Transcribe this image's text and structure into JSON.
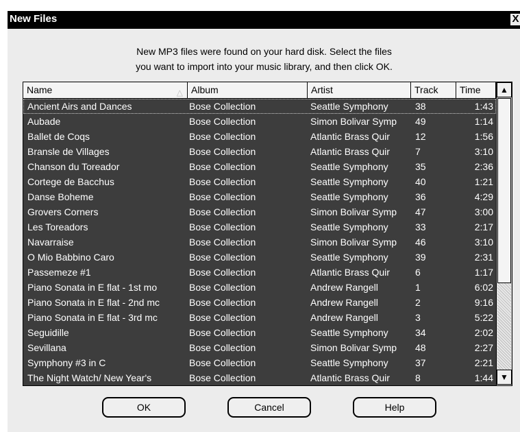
{
  "window": {
    "title": "New Files",
    "close_label": "X"
  },
  "message": {
    "line1": "New MP3 files were found on your hard disk. Select the files",
    "line2": "you want to import into your music library, and then click OK."
  },
  "columns": [
    "Name",
    "Album",
    "Artist",
    "Track",
    "Time"
  ],
  "rows": [
    [
      "Ancient Airs and Dances",
      "Bose Collection",
      "Seattle Symphony",
      "38",
      "1:43"
    ],
    [
      "Aubade",
      "Bose Collection",
      "Simon Bolivar Symp",
      "49",
      "1:14"
    ],
    [
      "Ballet de Coqs",
      "Bose Collection",
      "Atlantic Brass Quir",
      "12",
      "1:56"
    ],
    [
      "Bransle de Villages",
      "Bose Collection",
      "Atlantic Brass Quir",
      "7",
      "3:10"
    ],
    [
      "Chanson du Toreador",
      "Bose Collection",
      "Seattle Symphony",
      "35",
      "2:36"
    ],
    [
      "Cortege de Bacchus",
      "Bose Collection",
      "Seattle Symphony",
      "40",
      "1:21"
    ],
    [
      "Danse Boheme",
      "Bose Collection",
      "Seattle Symphony",
      "36",
      "4:29"
    ],
    [
      "Grovers Corners",
      "Bose Collection",
      "Simon Bolivar Symp",
      "47",
      "3:00"
    ],
    [
      "Les Toreadors",
      "Bose Collection",
      "Seattle Symphony",
      "33",
      "2:17"
    ],
    [
      "Navarraise",
      "Bose Collection",
      "Simon Bolivar Symp",
      "46",
      "3:10"
    ],
    [
      "O Mio Babbino Caro",
      "Bose Collection",
      "Seattle Symphony",
      "39",
      "2:31"
    ],
    [
      "Passemeze #1",
      "Bose Collection",
      "Atlantic Brass Quir",
      "6",
      "1:17"
    ],
    [
      "Piano Sonata in E flat - 1st mo",
      "Bose Collection",
      "Andrew Rangell",
      "1",
      "6:02"
    ],
    [
      "Piano Sonata in E flat - 2nd mc",
      "Bose Collection",
      "Andrew Rangell",
      "2",
      "9:16"
    ],
    [
      "Piano Sonata in E flat - 3rd mc",
      "Bose Collection",
      "Andrew Rangell",
      "3",
      "5:22"
    ],
    [
      "Seguidille",
      "Bose Collection",
      "Seattle Symphony",
      "34",
      "2:02"
    ],
    [
      "Sevillana",
      "Bose Collection",
      "Simon Bolivar Symp",
      "48",
      "2:27"
    ],
    [
      "Symphony #3 in C",
      "Bose Collection",
      "Seattle Symphony",
      "37",
      "2:21"
    ],
    [
      "The Night Watch/ New Year's",
      "Bose Collection",
      "Atlantic Brass Quir",
      "8",
      "1:44"
    ]
  ],
  "icons": {
    "sort": "sort-ascending-icon",
    "scroll_up": "arrow-up-icon",
    "scroll_down": "arrow-down-icon"
  },
  "buttons": {
    "ok": "OK",
    "cancel": "Cancel",
    "help": "Help"
  }
}
